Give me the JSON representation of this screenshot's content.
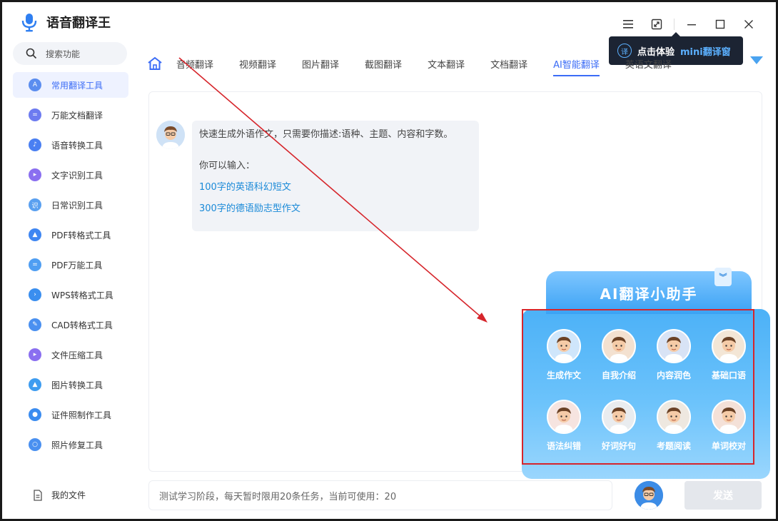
{
  "app": {
    "title": "语音翻译王"
  },
  "window": {
    "menu_icon": "menu-icon",
    "mini_icon": "mini-window-icon"
  },
  "mini_tooltip": {
    "icon_char": "译",
    "text": "点击体验",
    "accent": "mini翻译窗"
  },
  "colors": {
    "accent": "#3b6cf6",
    "link": "#1a8ad8",
    "annotation_red": "#d6252b",
    "assistant_blue": "#4cb1f7"
  },
  "sidebar": {
    "search_placeholder": "搜索功能",
    "items": [
      {
        "label": "常用翻译工具",
        "icon": "translate-icon",
        "glyph": "A",
        "color": "#5b8def",
        "active": true
      },
      {
        "label": "万能文档翻译",
        "icon": "document-icon",
        "glyph": "=",
        "color": "#6d7bf0"
      },
      {
        "label": "语音转换工具",
        "icon": "music-icon",
        "glyph": "♪",
        "color": "#4a7ff2"
      },
      {
        "label": "文字识别工具",
        "icon": "text-recognition-icon",
        "glyph": "▸",
        "color": "#8a6ff0"
      },
      {
        "label": "日常识别工具",
        "icon": "scan-icon",
        "glyph": "识",
        "color": "#5aa0f0"
      },
      {
        "label": "PDF转格式工具",
        "icon": "pdf-convert-icon",
        "glyph": "▲",
        "color": "#3f86f2"
      },
      {
        "label": "PDF万能工具",
        "icon": "pdf-tool-icon",
        "glyph": "=",
        "color": "#4f9ef2"
      },
      {
        "label": "WPS转格式工具",
        "icon": "wps-icon",
        "glyph": "›",
        "color": "#3a8eef"
      },
      {
        "label": "CAD转格式工具",
        "icon": "cad-icon",
        "glyph": "✎",
        "color": "#4a90f0"
      },
      {
        "label": "文件压缩工具",
        "icon": "compress-icon",
        "glyph": "▸",
        "color": "#8a6ff0"
      },
      {
        "label": "图片转换工具",
        "icon": "image-icon",
        "glyph": "▲",
        "color": "#3e9cf0"
      },
      {
        "label": "证件照制作工具",
        "icon": "id-photo-icon",
        "glyph": "●",
        "color": "#3b8cf0"
      },
      {
        "label": "照片修复工具",
        "icon": "photo-repair-icon",
        "glyph": "○",
        "color": "#4a90f0"
      }
    ],
    "my_files": "我的文件"
  },
  "tabs": {
    "items": [
      {
        "label": "音频翻译"
      },
      {
        "label": "视频翻译"
      },
      {
        "label": "图片翻译"
      },
      {
        "label": "截图翻译"
      },
      {
        "label": "文本翻译"
      },
      {
        "label": "文档翻译"
      },
      {
        "label": "AI智能翻译",
        "active": true
      },
      {
        "label": "英语文翻译"
      }
    ]
  },
  "chat": {
    "intro": "快速生成外语作文，只需要你描述:语种、主题、内容和字数。",
    "hint": "你可以输入：",
    "example1": "100字的英语科幻短文",
    "example2": "300字的德语励志型作文"
  },
  "assistant": {
    "title": "AI翻译小助手",
    "collapse_glyph": "︾",
    "helpers": [
      {
        "label": "生成作文",
        "icon": "avatar-writer-icon"
      },
      {
        "label": "自我介绍",
        "icon": "avatar-intro-icon"
      },
      {
        "label": "内容润色",
        "icon": "avatar-polish-icon"
      },
      {
        "label": "基础口语",
        "icon": "avatar-speaking-icon"
      },
      {
        "label": "语法纠错",
        "icon": "avatar-grammar-icon"
      },
      {
        "label": "好词好句",
        "icon": "avatar-phrases-icon"
      },
      {
        "label": "考题阅读",
        "icon": "avatar-reading-icon"
      },
      {
        "label": "单词校对",
        "icon": "avatar-vocab-icon"
      }
    ]
  },
  "input": {
    "text": "测试学习阶段，每天暂时限用20条任务，当前可使用：20",
    "send_label": "发送"
  }
}
